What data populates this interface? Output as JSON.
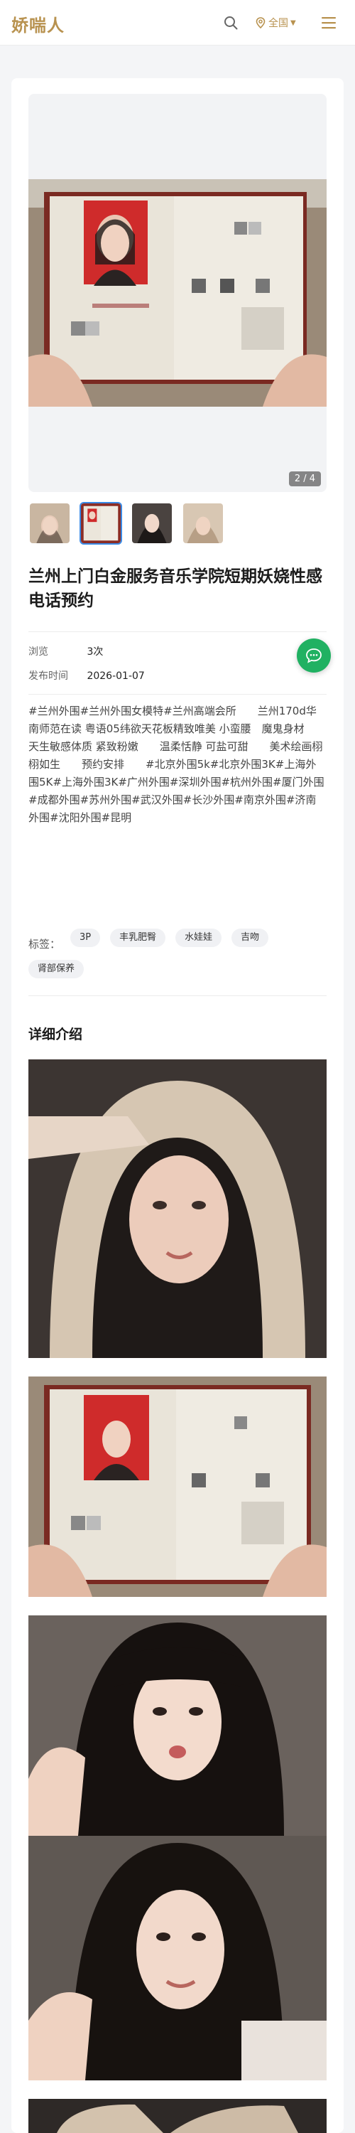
{
  "header": {
    "logo": "娇喘人",
    "location_label": "全国",
    "icons": [
      "search-icon",
      "location-icon",
      "menu-icon"
    ]
  },
  "gallery": {
    "counter": "2 / 4",
    "thumbnail_count": 4,
    "active_thumbnail": 2
  },
  "post": {
    "title": "兰州上门白金服务音乐学院短期妖娆性感电话预约",
    "meta": [
      {
        "key": "浏览",
        "value": "3次"
      },
      {
        "key": "发布时间",
        "value": "2026-01-07"
      }
    ],
    "description": "#兰州外围#兰州外围女模特#兰州高端会所　　兰州170d华南师范在读 粤语05纬欲天花板精致唯美 小蛮腰　魔鬼身材　　天生敏感体质 紧致粉嫩　　温柔恬静 可盐可甜　　美术绘画栩栩如生　　预约安排　　#北京外围5k#北京外围3K#上海外围5K#上海外围3K#广州外围#深圳外围#杭州外围#厦门外围#成都外围#苏州外围#武汉外围#长沙外围#南京外围#济南外围#沈阳外围#昆明",
    "tags_label": "标签：",
    "tags": [
      "3P",
      "丰乳肥臀",
      "水娃娃",
      "吉吻",
      "肾部保养"
    ],
    "section_title": "详细介绍"
  },
  "colors": {
    "brand": "#b8924f",
    "accent": "#3a8be6",
    "chat": "#20b162"
  }
}
